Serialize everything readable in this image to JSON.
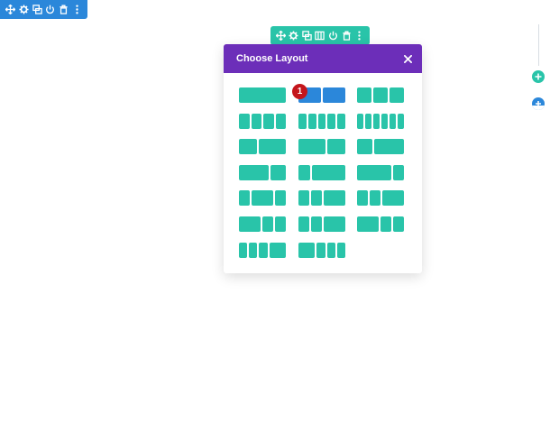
{
  "colors": {
    "section_toolbar": "#2b87da",
    "row_toolbar": "#29c4a9",
    "modal_header": "#6c2eb9",
    "column": "#29c4a9",
    "column_highlight": "#2b87da",
    "badge": "#c4161c",
    "add_module": "#29c4a9",
    "add_section": "#2b87da"
  },
  "section_toolbar": {
    "buttons": [
      "move-icon",
      "gear-icon",
      "duplicate-icon",
      "power-icon",
      "trash-icon",
      "more-icon"
    ]
  },
  "row_toolbar": {
    "buttons": [
      "move-icon",
      "gear-icon",
      "duplicate-icon",
      "columns-icon",
      "power-icon",
      "trash-icon",
      "more-icon"
    ]
  },
  "modal": {
    "title": "Choose Layout",
    "close_icon": "close-icon",
    "layouts": [
      [
        1
      ],
      [
        1,
        1
      ],
      [
        1,
        1,
        1
      ],
      [
        1,
        1,
        1,
        1
      ],
      [
        1,
        1,
        1,
        1,
        1
      ],
      [
        1,
        1,
        1,
        1,
        1,
        1
      ],
      [
        2,
        3
      ],
      [
        3,
        2
      ],
      [
        1,
        2
      ],
      [
        2,
        1
      ],
      [
        1,
        3
      ],
      [
        3,
        1
      ],
      [
        1,
        2,
        1
      ],
      [
        1,
        1,
        2
      ],
      [
        1,
        1,
        2
      ],
      [
        2,
        1,
        1
      ],
      [
        1,
        1,
        2
      ],
      [
        2,
        1,
        1
      ],
      [
        1,
        1,
        1,
        2
      ],
      [
        2,
        1,
        1,
        1
      ]
    ],
    "highlighted_index": 1
  },
  "badge": "1",
  "side_controls": [
    "add-module-icon",
    "add-section-icon"
  ]
}
